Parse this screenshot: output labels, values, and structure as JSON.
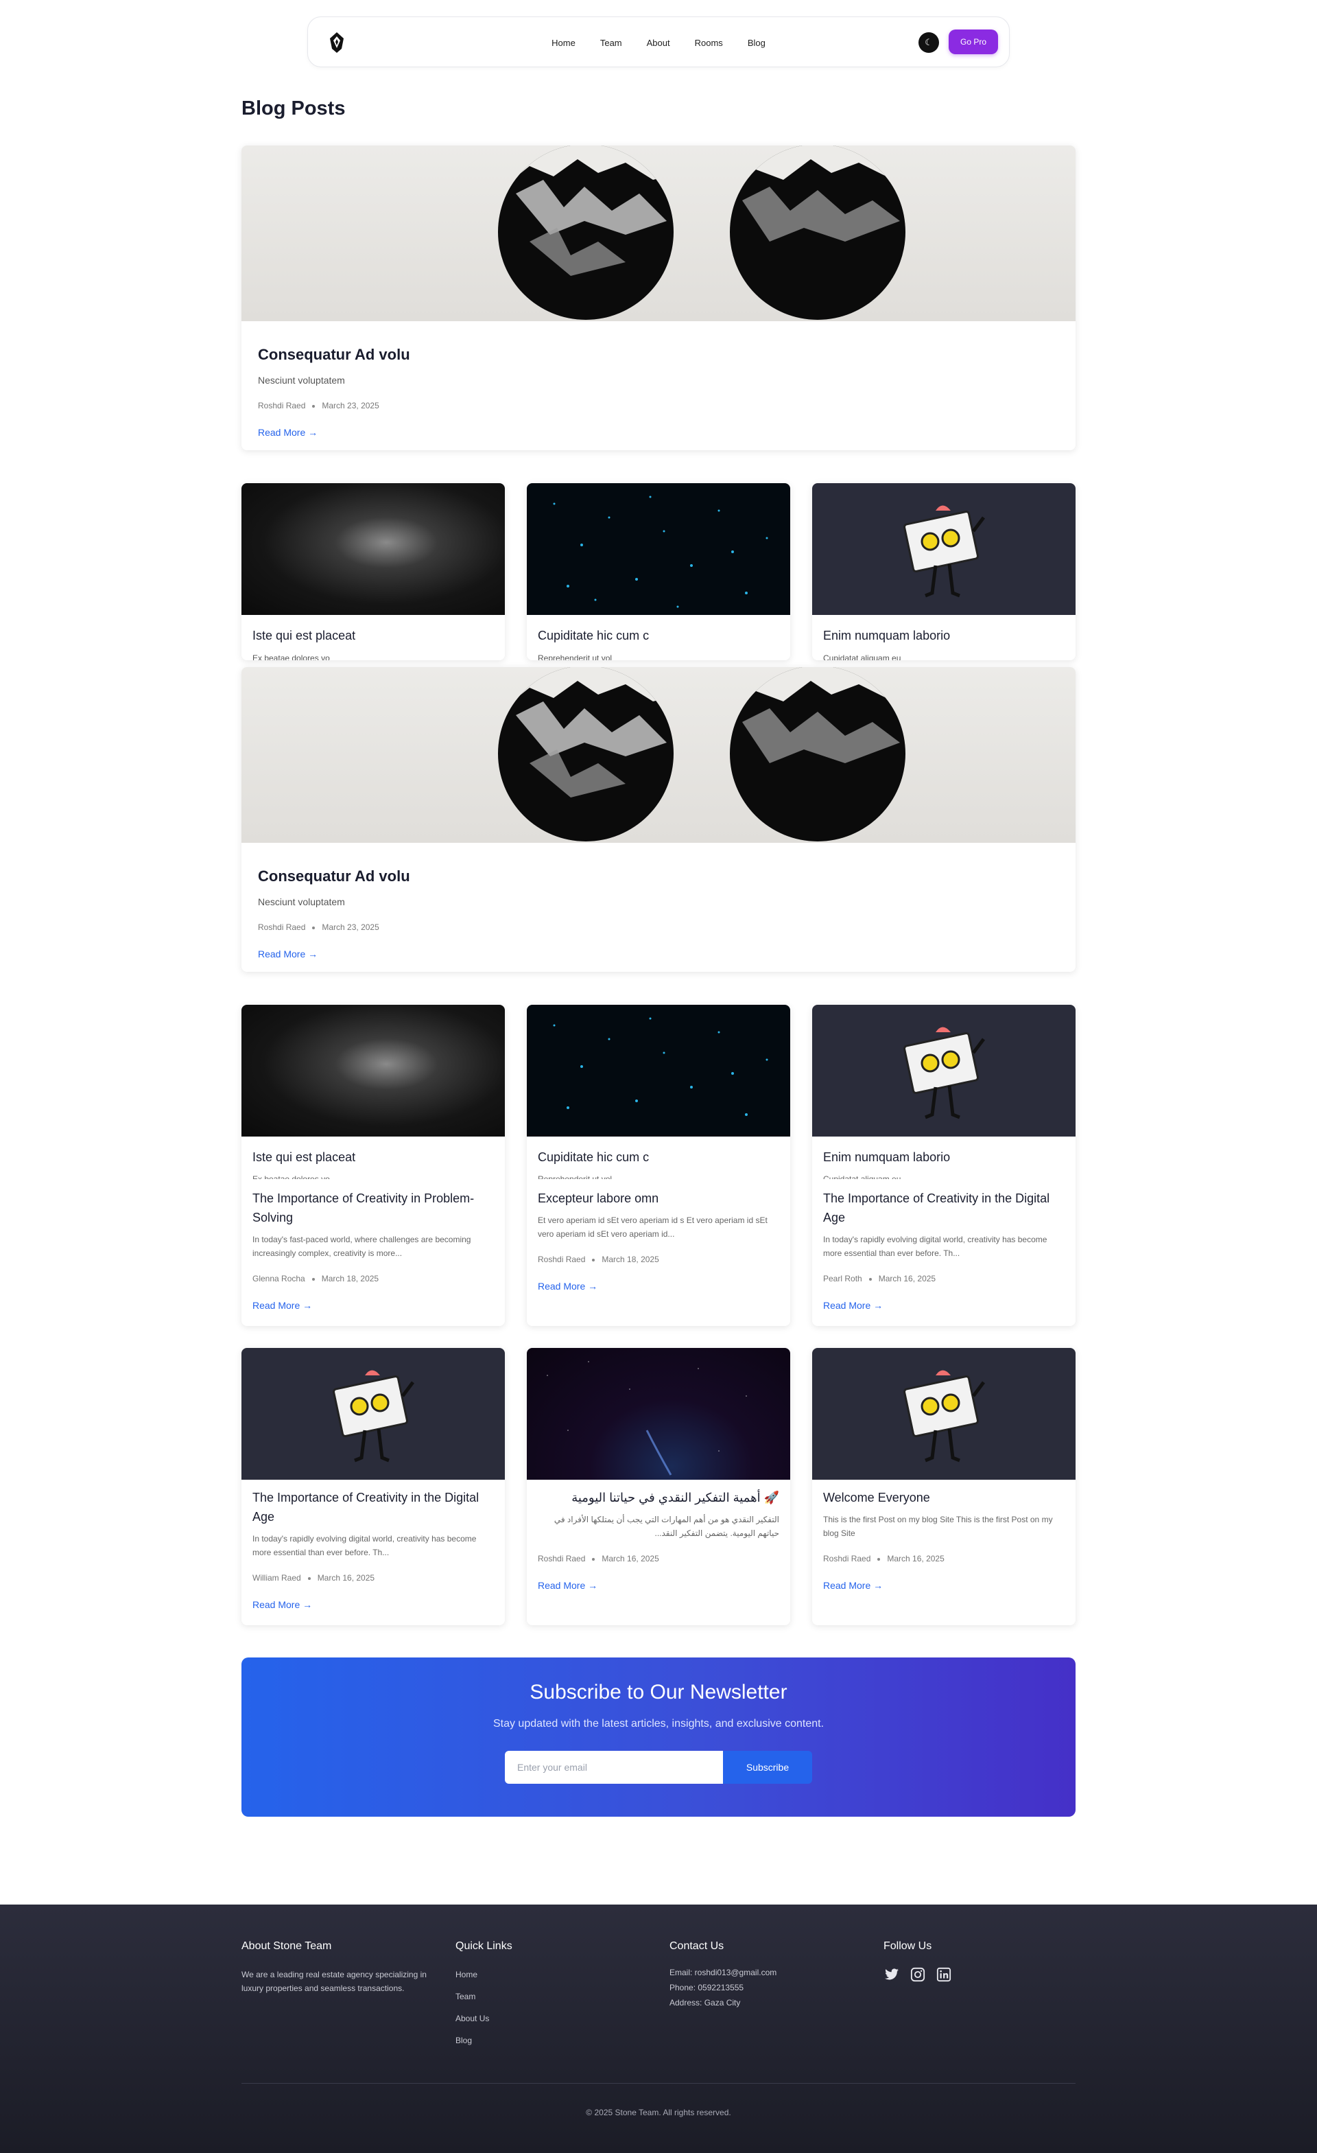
{
  "nav": {
    "links": [
      "Home",
      "Team",
      "About",
      "Rooms",
      "Blog"
    ],
    "theme_icon": "sun-moon-icon",
    "cta": "Go Pro"
  },
  "page_title": "Blog Posts",
  "featured": {
    "title": "Consequatur Ad volu",
    "desc": "Nesciunt voluptatem",
    "author": "Roshdi Raed",
    "date": "March 23, 2025",
    "read_more": "Read More →"
  },
  "clipped_cards": [
    {
      "title": "Iste qui est placeat",
      "desc": "Ex beatae dolores vo"
    },
    {
      "title": "Cupiditate hic cum c",
      "desc": "Reprehenderit ut vol"
    },
    {
      "title": "Enim numquam laborio",
      "desc": "Cupidatat aliquam eu"
    }
  ],
  "posts_row1": [
    {
      "title": "The Importance of Creativity in Problem-Solving",
      "desc": "In today's fast-paced world, where challenges are becoming increasingly complex, creativity is more...",
      "author": "Glenna Rocha",
      "date": "March 18, 2025",
      "read_more": "Read More →"
    },
    {
      "title": "Excepteur labore omn",
      "desc": "Et vero aperiam id sEt vero aperiam id s Et vero aperiam id sEt vero aperiam id sEt vero aperiam id...",
      "author": "Roshdi Raed",
      "date": "March 18, 2025",
      "read_more": "Read More →"
    },
    {
      "title": "The Importance of Creativity in the Digital Age",
      "desc": "In today's rapidly evolving digital world, creativity has become more essential than ever before. Th...",
      "author": "Pearl Roth",
      "date": "March 16, 2025",
      "read_more": "Read More →"
    }
  ],
  "posts_row2": [
    {
      "title": "The Importance of Creativity in the Digital Age",
      "desc": "In today's rapidly evolving digital world, creativity has become more essential than ever before. Th...",
      "author": "William Raed",
      "date": "March 16, 2025",
      "read_more": "Read More →"
    },
    {
      "title": "🚀 أهمية التفكير النقدي في حياتنا اليومية",
      "desc": "التفكير النقدي هو من أهم المهارات التي يجب أن يمتلكها الأفراد في حياتهم اليومية. يتضمن التفكير النقد...",
      "author": "Roshdi Raed",
      "date": "March 16, 2025",
      "read_more": "Read More →"
    },
    {
      "title": "Welcome Everyone",
      "desc": "This is the first Post on my blog Site This is the first Post on my blog Site",
      "author": "Roshdi Raed",
      "date": "March 16, 2025",
      "read_more": "Read More →"
    }
  ],
  "newsletter": {
    "title": "Subscribe to Our Newsletter",
    "subtitle": "Stay updated with the latest articles, insights, and exclusive content.",
    "placeholder": "Enter your email",
    "button": "Subscribe"
  },
  "footer": {
    "about_title": "About Stone Team",
    "about_text": "We are a leading real estate agency specializing in luxury properties and seamless transactions.",
    "links_title": "Quick Links",
    "links": [
      "Home",
      "Team",
      "About Us",
      "Blog"
    ],
    "contact_title": "Contact Us",
    "email": "Email: roshdi013@gmail.com",
    "phone": "Phone: 0592213555",
    "address": "Address: Gaza City",
    "follow_title": "Follow Us",
    "social_icons": [
      "twitter-icon",
      "instagram-icon",
      "linkedin-icon"
    ],
    "copyright": "© 2025 Stone Team. All rights reserved."
  }
}
